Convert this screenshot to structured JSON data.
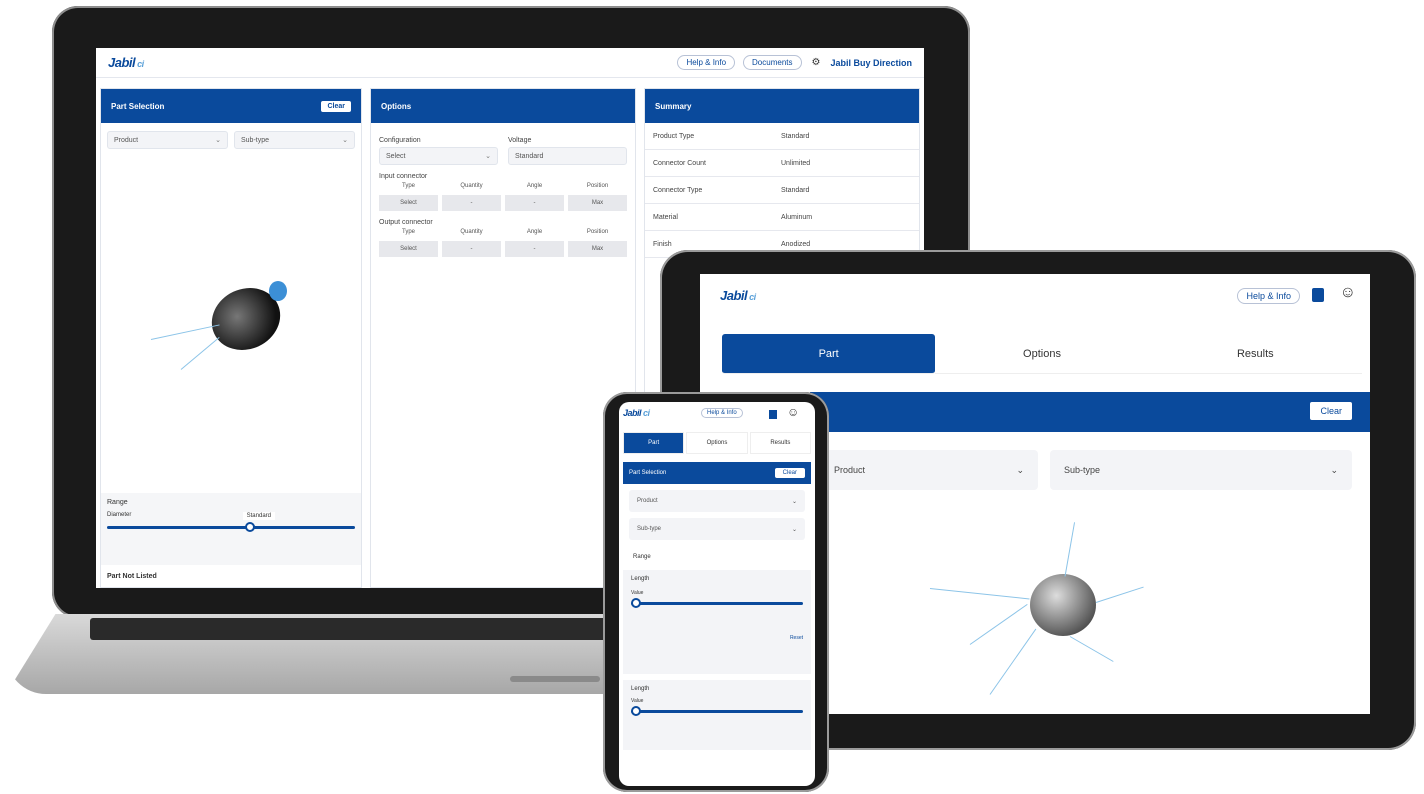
{
  "brand": {
    "logo": "Jabil",
    "suffix": "ci"
  },
  "laptop": {
    "header": {
      "pill1": "Help & Info",
      "pill2": "Documents",
      "user": "Jabil Buy Direction"
    },
    "col1": {
      "title": "Part Selection",
      "button": "Clear",
      "select1": "Product",
      "select2": "Sub-type",
      "section_label": "Range",
      "slider_label": "Diameter",
      "slider_value": "Standard",
      "footer_label": "Part Not Listed"
    },
    "col2": {
      "title": "Options",
      "label_left": "Configuration",
      "label_right": "Voltage",
      "select_left": "Select",
      "select_right": "Standard",
      "group1": "Input connector",
      "group2": "Output connector",
      "headers": [
        "Type",
        "Quantity",
        "Angle",
        "Position"
      ],
      "row1": [
        "Select",
        "-",
        "-",
        "Max"
      ],
      "row2": [
        "Select",
        "-",
        "-",
        "Max"
      ]
    },
    "col3": {
      "title": "Summary",
      "rows": [
        {
          "k": "Product Type",
          "v": "Standard"
        },
        {
          "k": "Connector Count",
          "v": "Unlimited"
        },
        {
          "k": "Connector Type",
          "v": "Standard"
        },
        {
          "k": "Material",
          "v": "Aluminum"
        },
        {
          "k": "Finish",
          "v": "Anodized"
        }
      ]
    }
  },
  "tablet": {
    "pill": "Help & Info",
    "tabs": [
      "Part",
      "Options",
      "Results"
    ],
    "button": "Clear",
    "select1": "Product",
    "select2": "Sub-type"
  },
  "phone": {
    "pill": "Help & Info",
    "tabs": [
      "Part",
      "Options",
      "Results"
    ],
    "head": "Part Selection",
    "button": "Clear",
    "select1": "Product",
    "select2": "Sub-type",
    "range_label": "Range",
    "slider1_label": "Length",
    "slider1_sub": "Value",
    "reset": "Reset",
    "slider2_label": "Length",
    "slider2_sub": "Value"
  },
  "colors": {
    "primary": "#0a4a9c",
    "accent": "#8cc4e8"
  }
}
